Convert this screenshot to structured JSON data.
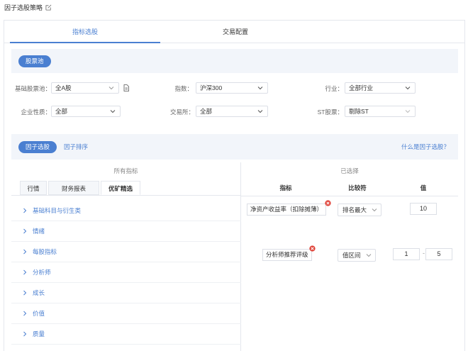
{
  "page": {
    "title": "因子选股策略"
  },
  "main_tabs": {
    "tab1": "指标选股",
    "tab2": "交易配置"
  },
  "section1": {
    "pill": "股票池"
  },
  "filters": {
    "base_pool": {
      "label": "基础股票池：",
      "value": "全A股"
    },
    "index": {
      "label": "指数：",
      "value": "沪深300"
    },
    "industry": {
      "label": "行业：",
      "value": "全部行业"
    },
    "nature": {
      "label": "企业性质：",
      "value": "全部"
    },
    "exchange": {
      "label": "交易所：",
      "value": "全部"
    },
    "st": {
      "label": "ST股票：",
      "value": "剔除ST"
    }
  },
  "section2": {
    "pill": "因子选股",
    "sub_tab": "因子排序",
    "help": "什么是因子选股？"
  },
  "left": {
    "header": "所有指标",
    "tabs": [
      "行情",
      "财务报表",
      "优矿精选"
    ],
    "categories": [
      "基础科目与衍生类",
      "情绪",
      "每股指标",
      "分析师",
      "成长",
      "价值",
      "质量"
    ]
  },
  "right": {
    "header": "已选择",
    "columns": [
      "指标",
      "比较符",
      "值"
    ],
    "rows": [
      {
        "indicator": "净资产收益率（扣除摊薄）",
        "compare": "排名最大",
        "value": "10"
      },
      {
        "indicator": "分析师推荐评级",
        "compare": "值区间",
        "value_min": "1",
        "value_max": "5"
      }
    ],
    "range_sep": "-"
  },
  "colors": {
    "accent": "#4a7fd1",
    "bar_bg": "#f2f5fa",
    "close": "#e0443a"
  },
  "icons": [
    "edit-icon",
    "chevron-down-icon",
    "document-icon",
    "chevron-right-icon",
    "close-icon"
  ]
}
